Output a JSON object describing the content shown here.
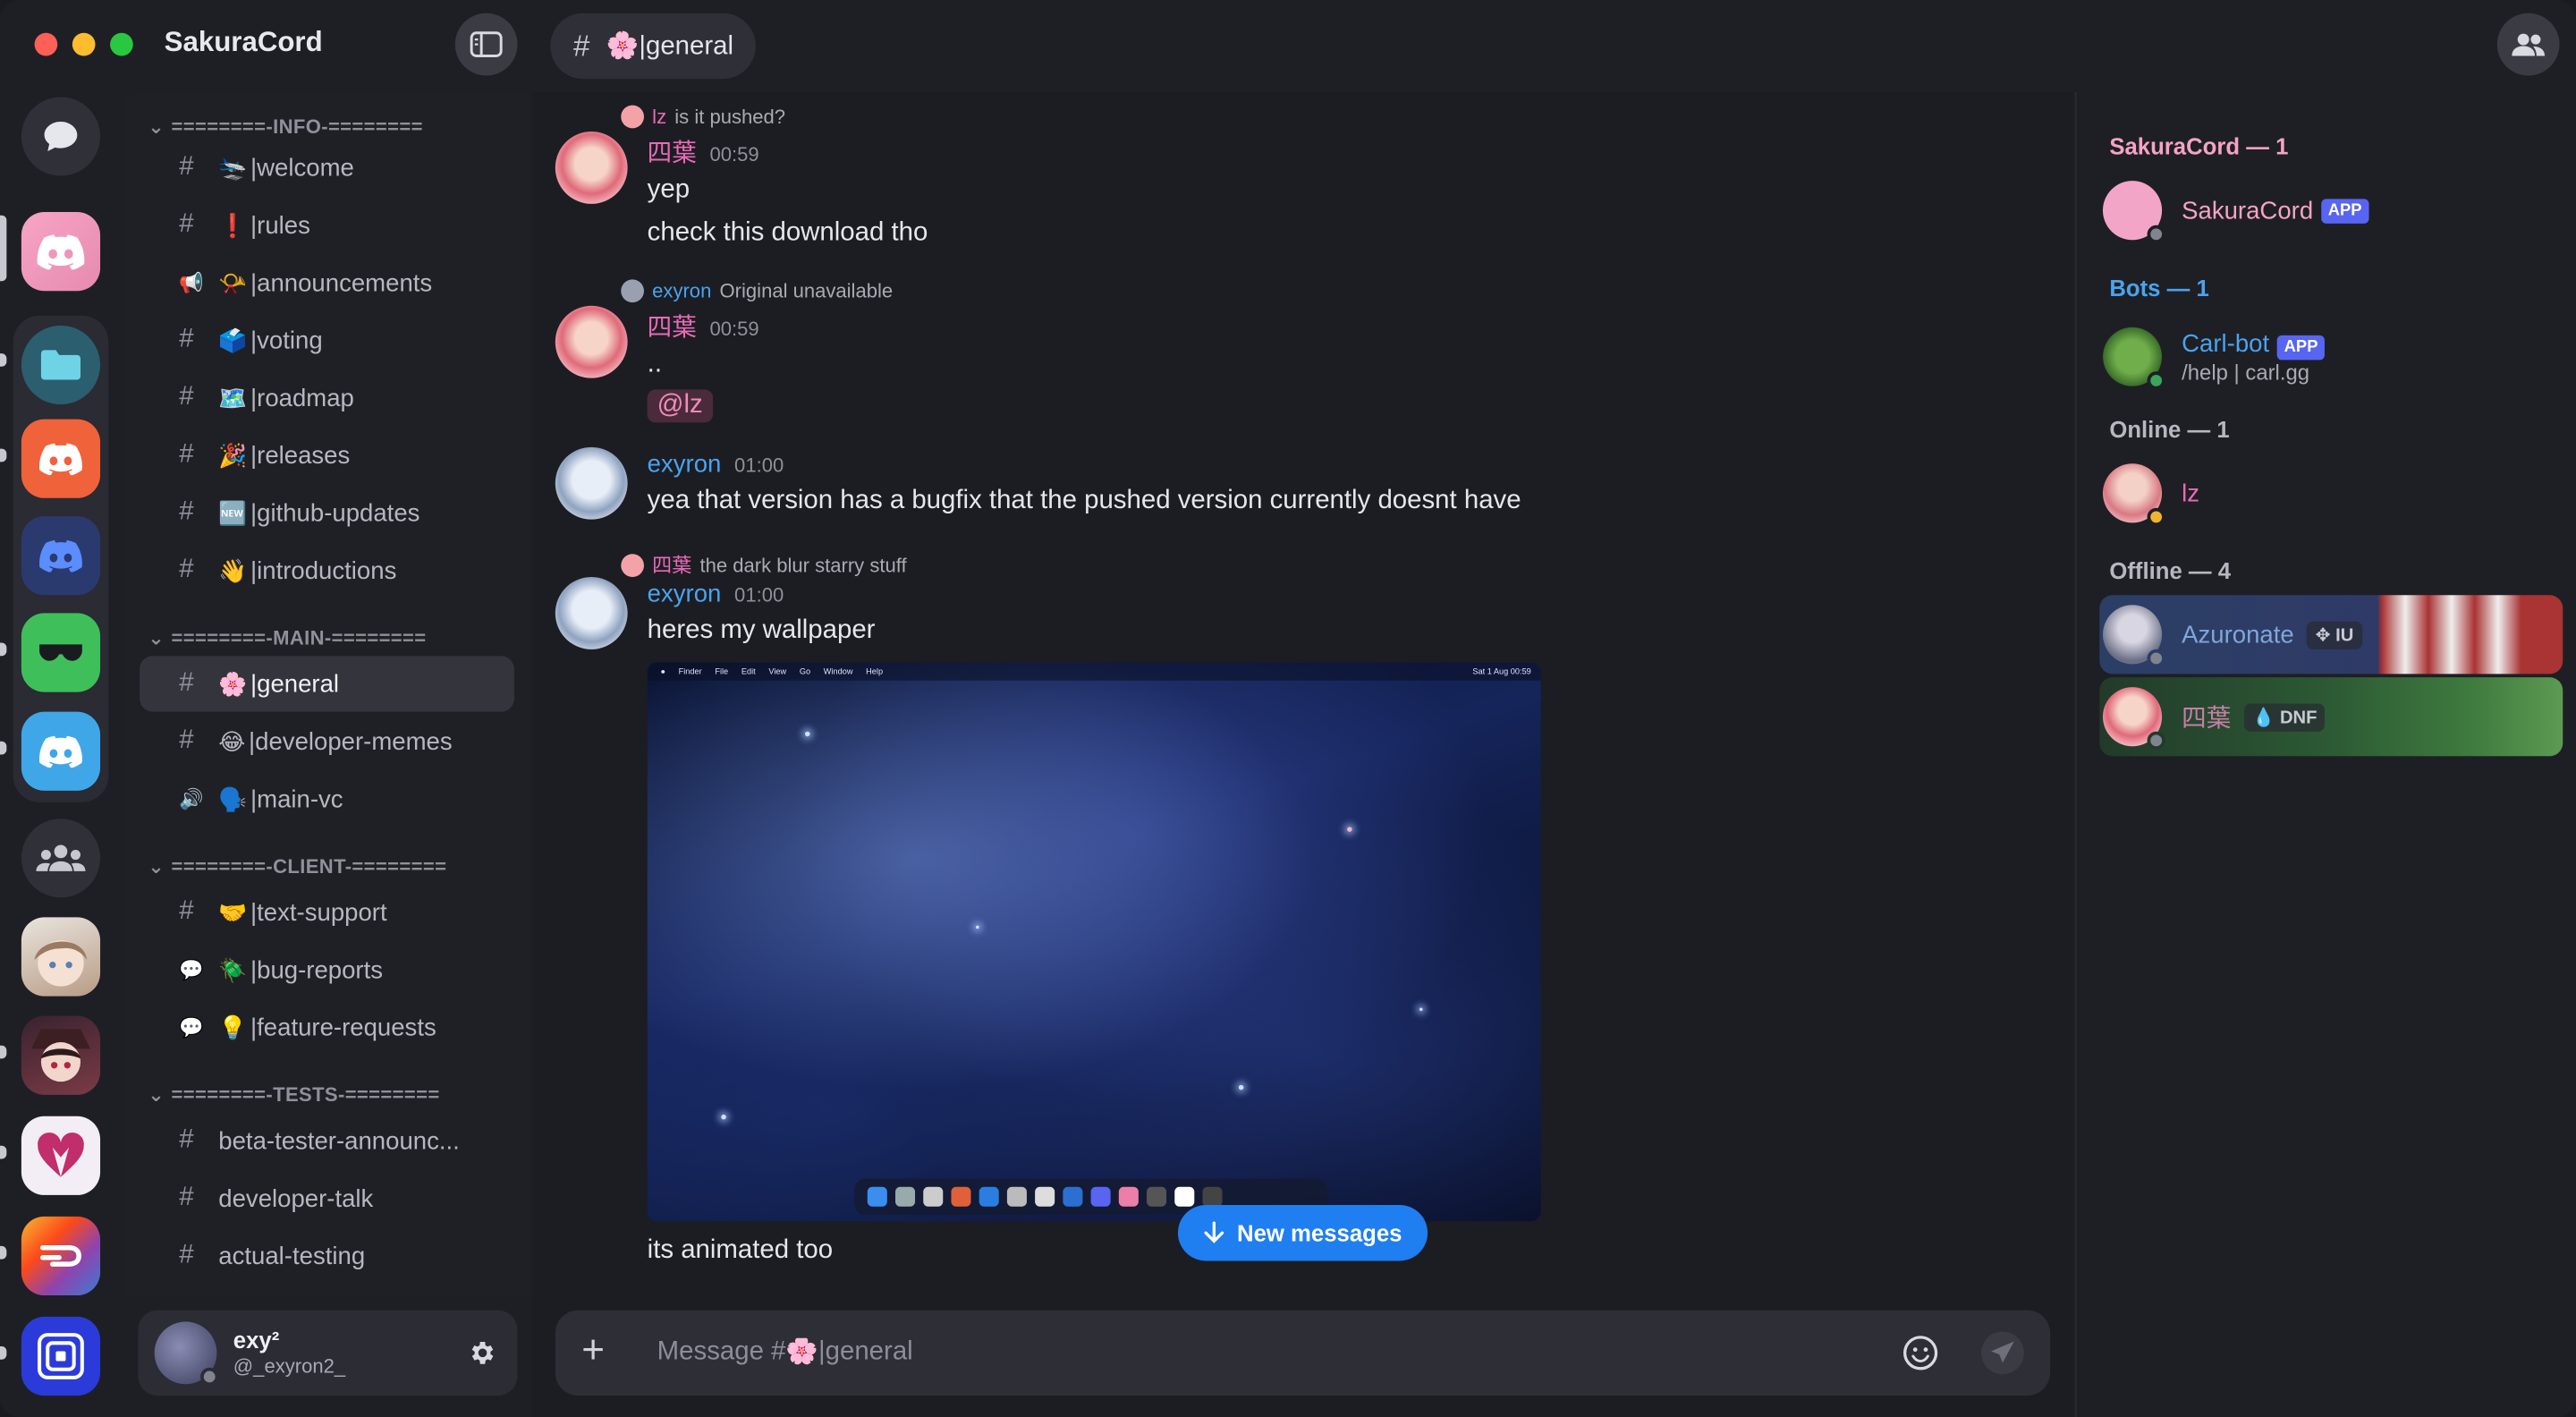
{
  "app": {
    "title": "SakuraCord"
  },
  "top_tab": {
    "hash": "#",
    "emoji": "🌸",
    "name": "|general"
  },
  "categories": {
    "info": "========-INFO-========",
    "main": "========-MAIN-========",
    "client": "========-CLIENT-========",
    "tests": "========-TESTS-========"
  },
  "channels": [
    {
      "sym": "#",
      "emoji": "🛬",
      "name": "|welcome"
    },
    {
      "sym": "#",
      "emoji": "❗",
      "name": "|rules"
    },
    {
      "sym": "📢",
      "emoji": "📯",
      "name": "|announcements"
    },
    {
      "sym": "#",
      "emoji": "🗳️",
      "name": "|voting"
    },
    {
      "sym": "#",
      "emoji": "🗺️",
      "name": "|roadmap"
    },
    {
      "sym": "#",
      "emoji": "🎉",
      "name": "|releases"
    },
    {
      "sym": "#",
      "emoji": "🆕",
      "name": "|github-updates"
    },
    {
      "sym": "#",
      "emoji": "👋",
      "name": "|introductions"
    },
    {
      "sym": "#",
      "emoji": "🌸",
      "name": "|general"
    },
    {
      "sym": "#",
      "emoji": "😂",
      "name": "|developer-memes"
    },
    {
      "sym": "🔊",
      "emoji": "🗣️",
      "name": "|main-vc"
    },
    {
      "sym": "#",
      "emoji": "🤝",
      "name": "|text-support"
    },
    {
      "sym": "💬",
      "emoji": "🪲",
      "name": "|bug-reports"
    },
    {
      "sym": "💬",
      "emoji": "💡",
      "name": "|feature-requests"
    },
    {
      "sym": "#",
      "emoji": "",
      "name": "beta-tester-announc..."
    },
    {
      "sym": "#",
      "emoji": "",
      "name": "developer-talk"
    },
    {
      "sym": "#",
      "emoji": "",
      "name": "actual-testing"
    }
  ],
  "user": {
    "display": "exy²",
    "handle": "@_exyron2_"
  },
  "messages": {
    "m1": {
      "reply_user": "lz",
      "reply_text": "is it pushed?",
      "author": "四葉",
      "time": "00:59",
      "lines": [
        "yep",
        "check this download tho"
      ]
    },
    "m2": {
      "reply_user": "exyron",
      "reply_text": "Original unavailable",
      "author": "四葉",
      "time": "00:59",
      "lines": [
        ".."
      ],
      "mention": "@lz"
    },
    "m3": {
      "author": "exyron",
      "time": "01:00",
      "lines": [
        "yea that version has a bugfix that the pushed version currently doesnt have"
      ]
    },
    "m4": {
      "reply_user": "四葉",
      "reply_text": "the dark blur starry stuff",
      "author": "exyron",
      "time": "01:00",
      "lines": [
        "heres my wallpaper"
      ],
      "after": "its animated too"
    }
  },
  "wallpaper_menubar": [
    "Finder",
    "File",
    "Edit",
    "View",
    "Go",
    "Window",
    "Help"
  ],
  "wallpaper_status": "Sat 1 Aug 00:59",
  "new_messages": "New messages",
  "composer": {
    "placeholder": "Message #🌸|general"
  },
  "members": {
    "groups": {
      "g1": "SakuraCord — 1",
      "g2": "Bots — 1",
      "g3": "Online — 1",
      "g4": "Offline — 4"
    },
    "sakuracord": {
      "name": "SakuraCord",
      "tag": "APP"
    },
    "carlbot": {
      "name": "Carl-bot",
      "tag": "APP",
      "status": "/help | carl.gg"
    },
    "lz": {
      "name": "lz"
    },
    "azuronate": {
      "name": "Azuronate",
      "guild_tag": "IU"
    },
    "yotsuba": {
      "name": "四葉",
      "guild_tag": "DNF"
    }
  },
  "colors": {
    "accent_blue": "#1f7ef0",
    "pink_name": "#e86bb8",
    "blue_name": "#4aa3ef",
    "app_tag": "#5865f2",
    "online": "#3ba55d",
    "idle": "#f0b232",
    "offline": "#80848e"
  }
}
